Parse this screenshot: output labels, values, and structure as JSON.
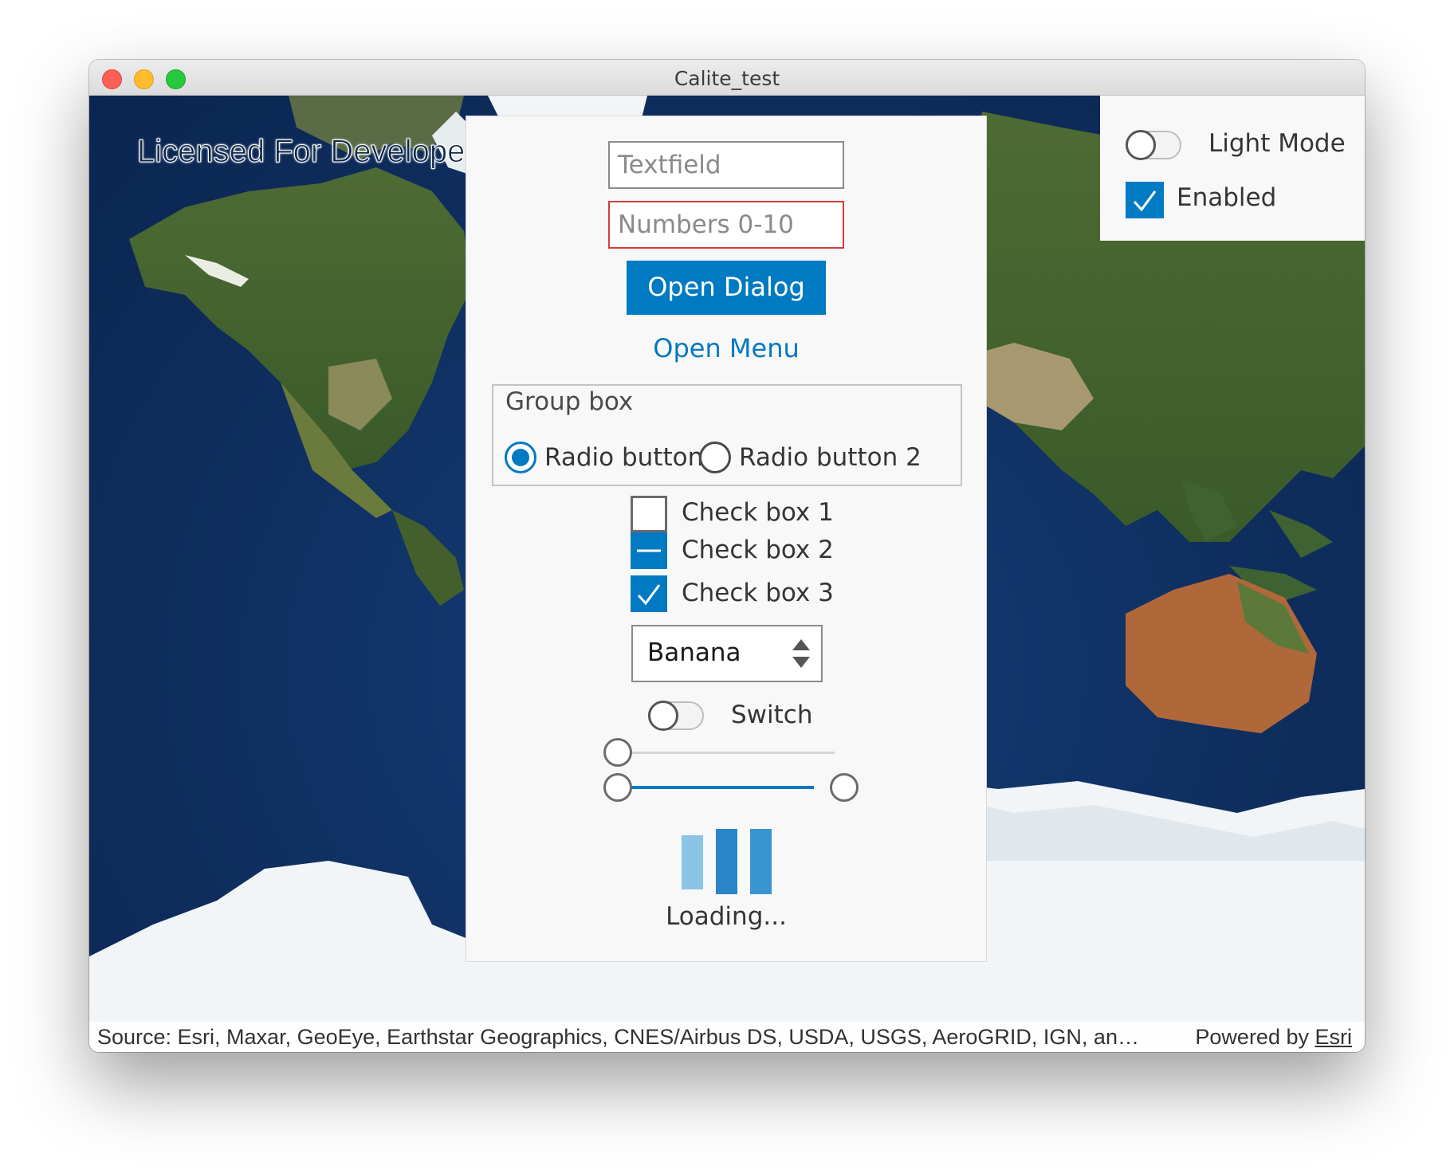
{
  "window": {
    "title": "Calite_test"
  },
  "map": {
    "licensed_text": "Licensed For Develope",
    "attribution_source": "Source: Esri, Maxar, GeoEye, Earthstar Geographics, CNES/Airbus DS, USDA, USGS, AeroGRID, IGN, an…",
    "powered_by_prefix": "Powered by ",
    "powered_by_link": "Esri"
  },
  "panel": {
    "textfield_placeholder": "Textfield",
    "numbers_placeholder": "Numbers 0-10",
    "open_dialog_label": "Open Dialog",
    "open_menu_label": "Open Menu",
    "group_box": {
      "title": "Group box",
      "radios": [
        {
          "label": "Radio button 1",
          "selected": true
        },
        {
          "label": "Radio button 2",
          "selected": false
        }
      ]
    },
    "checkboxes": [
      {
        "label": "Check box 1",
        "state": "unchecked"
      },
      {
        "label": "Check box 2",
        "state": "indeterminate"
      },
      {
        "label": "Check box 3",
        "state": "checked"
      }
    ],
    "select": {
      "value": "Banana"
    },
    "switch": {
      "label": "Switch",
      "on": false
    },
    "slider": {
      "value": 0
    },
    "range_slider": {
      "low": 0,
      "high": 1
    },
    "loading_label": "Loading..."
  },
  "top_right": {
    "light_mode_label": "Light Mode",
    "light_mode_on": false,
    "enabled_label": "Enabled",
    "enabled_checked": true
  },
  "colors": {
    "accent": "#007ac2",
    "error_border": "#d43b3b",
    "link": "#0079c1"
  }
}
